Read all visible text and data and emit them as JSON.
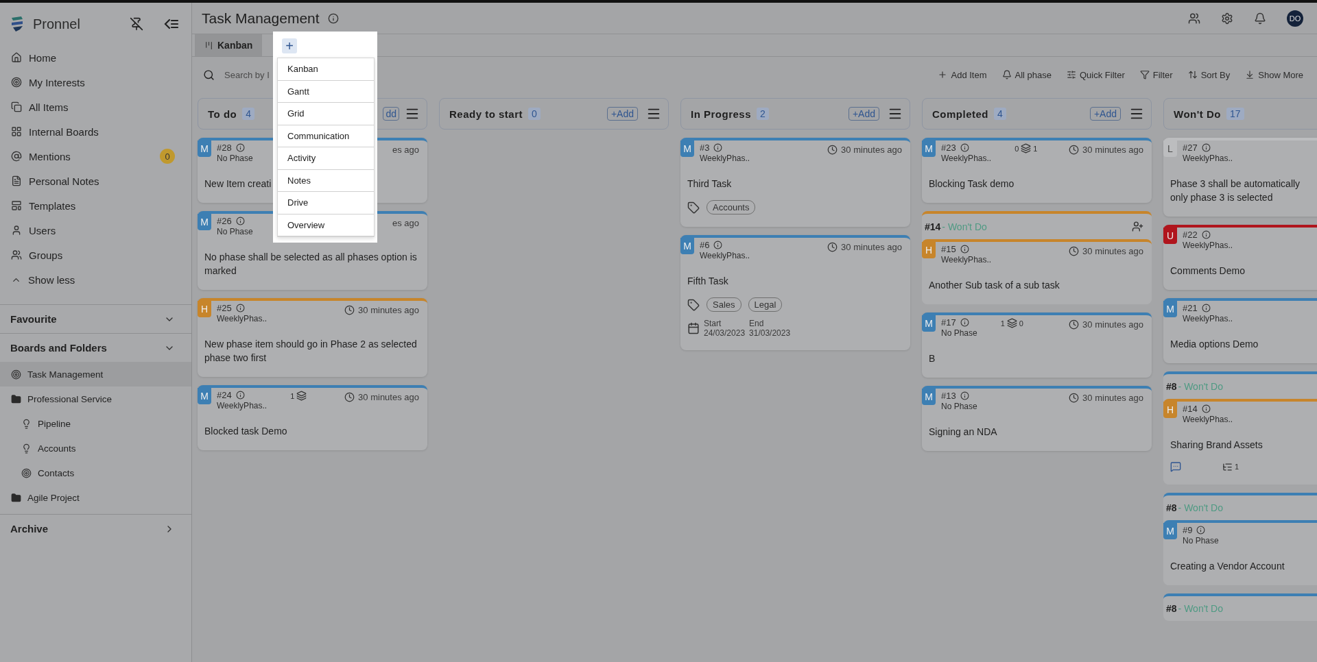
{
  "sidebar": {
    "brand": "Pronnel",
    "nav": [
      {
        "label": "Home"
      },
      {
        "label": "My Interests"
      },
      {
        "label": "All Items"
      },
      {
        "label": "Internal Boards"
      },
      {
        "label": "Mentions",
        "badge": "0"
      },
      {
        "label": "Personal Notes"
      },
      {
        "label": "Templates"
      },
      {
        "label": "Users"
      },
      {
        "label": "Groups"
      }
    ],
    "show_less": "Show less",
    "favourite": "Favourite",
    "boards_title": "Boards and Folders",
    "tree": [
      {
        "label": "Task Management",
        "kind": "board",
        "selected": true
      },
      {
        "label": "Professional Service",
        "kind": "folder",
        "selected": false,
        "children": [
          {
            "label": "Pipeline",
            "kind": "bulb",
            "selected": false
          },
          {
            "label": "Accounts",
            "kind": "bulb",
            "selected": false
          },
          {
            "label": "Contacts",
            "kind": "board",
            "selected": false
          }
        ]
      },
      {
        "label": "Agile Project",
        "kind": "folder",
        "selected": false
      }
    ],
    "archive": "Archive"
  },
  "header": {
    "title": "Task Management",
    "avatar": "DO"
  },
  "tabs": [
    {
      "label": "Kanban",
      "selected": true
    }
  ],
  "add_view": {
    "label": "+",
    "menu": [
      "Kanban",
      "Gantt",
      "Grid",
      "Communication",
      "Activity",
      "Notes",
      "Drive",
      "Overview"
    ]
  },
  "toolbar": {
    "search": {
      "placeholder": "Search by I"
    },
    "actions": [
      "Add Item",
      "All phase",
      "Quick Filter",
      "Filter",
      "Sort By",
      "Show More"
    ]
  },
  "columns": [
    {
      "title": "To do",
      "count": "4",
      "add": "dd",
      "items": [
        {
          "kind": "card",
          "priority": "M",
          "color": "#3d7fb3",
          "id": "#28",
          "phase": "No Phase",
          "time": "es ago",
          "title": "New Item creati"
        },
        {
          "kind": "card",
          "priority": "M",
          "color": "#3d7fb3",
          "id": "#26",
          "phase": "No Phase",
          "time": "es ago",
          "title": "No phase shall be selected as all phases option is marked"
        },
        {
          "kind": "card",
          "priority": "H",
          "color": "#c7852b",
          "id": "#25",
          "phase": "WeeklyPhas..",
          "time": "30 minutes ago",
          "title": "New phase item should go in Phase 2 as selected phase two first"
        },
        {
          "kind": "card",
          "priority": "M",
          "color": "#3d7fb3",
          "id": "#24",
          "phase": "WeeklyPhas..",
          "links": [
            "1"
          ],
          "time": "30 minutes ago",
          "title": "Blocked task Demo"
        }
      ]
    },
    {
      "title": "Ready to start",
      "count": "0",
      "add": "+Add"
    },
    {
      "title": "In Progress",
      "count": "2",
      "add": "+Add",
      "items": [
        {
          "kind": "card",
          "priority": "M",
          "color": "#3d7fb3",
          "id": "#3",
          "phase": "WeeklyPhas..",
          "time": "30 minutes ago",
          "title": "Third Task",
          "tags": [
            "Accounts"
          ]
        },
        {
          "kind": "card",
          "priority": "M",
          "color": "#3d7fb3",
          "id": "#6",
          "phase": "WeeklyPhas..",
          "time": "30 minutes ago",
          "title": "Fifth Task",
          "tags": [
            "Sales",
            "Legal"
          ],
          "dates": [
            {
              "label": "Start",
              "value": "24/03/2023"
            },
            {
              "label": "End",
              "value": "31/03/2023"
            }
          ]
        }
      ]
    },
    {
      "title": "Completed",
      "count": "4",
      "add": "+Add",
      "items": [
        {
          "kind": "card",
          "priority": "M",
          "color": "#3d7fb3",
          "id": "#23",
          "phase": "WeeklyPhas..",
          "links": [
            "0",
            "1"
          ],
          "time": "30 minutes ago",
          "title": "Blocking Task demo"
        },
        {
          "kind": "group",
          "color": "#c7852b",
          "id": "#14",
          "status": "- Won't Do",
          "items": [
            {
              "kind": "card",
              "priority": "H",
              "color": "#c7852b",
              "id": "#15",
              "phase": "WeeklyPhas..",
              "time": "30 minutes ago",
              "title": "Another Sub task of a sub task"
            }
          ]
        },
        {
          "kind": "card",
          "priority": "M",
          "color": "#3d7fb3",
          "id": "#17",
          "phase": "No Phase",
          "links": [
            "1",
            "0"
          ],
          "time": "30 minutes ago",
          "title": "B"
        },
        {
          "kind": "card",
          "priority": "M",
          "color": "#3d7fb3",
          "id": "#13",
          "phase": "No Phase",
          "time": "30 minutes ago",
          "title": "Signing an NDA"
        }
      ]
    },
    {
      "title": "Won't Do",
      "count": "17",
      "items": [
        {
          "kind": "card",
          "priority": "L",
          "color": "#bcbdbf",
          "id": "#27",
          "phase": "WeeklyPhas..",
          "title": "Phase 3 shall be automatically\nonly phase 3 is selected"
        },
        {
          "kind": "card",
          "priority": "U",
          "color": "#b0151d",
          "id": "#22",
          "phase": "WeeklyPhas..",
          "title": "Comments Demo"
        },
        {
          "kind": "card",
          "priority": "M",
          "color": "#3d7fb3",
          "id": "#21",
          "phase": "WeeklyPhas..",
          "title": "Media options Demo"
        },
        {
          "kind": "group",
          "color": "#3d7fb3",
          "id": "#8",
          "status": "- Won't Do",
          "items": [
            {
              "kind": "card",
              "priority": "H",
              "color": "#c7852b",
              "id": "#14",
              "phase": "WeeklyPhas..",
              "title": "Sharing Brand Assets",
              "subtasks": "1"
            }
          ]
        },
        {
          "kind": "group",
          "color": "#3d7fb3",
          "id": "#8",
          "status": "- Won't Do",
          "items": [
            {
              "kind": "card",
              "priority": "M",
              "color": "#3d7fb3",
              "id": "#9",
              "phase": "No Phase",
              "title": "Creating a Vendor Account"
            }
          ]
        },
        {
          "kind": "group",
          "color": "#3d7fb3",
          "id": "#8",
          "status": "- Won't Do"
        }
      ]
    }
  ]
}
